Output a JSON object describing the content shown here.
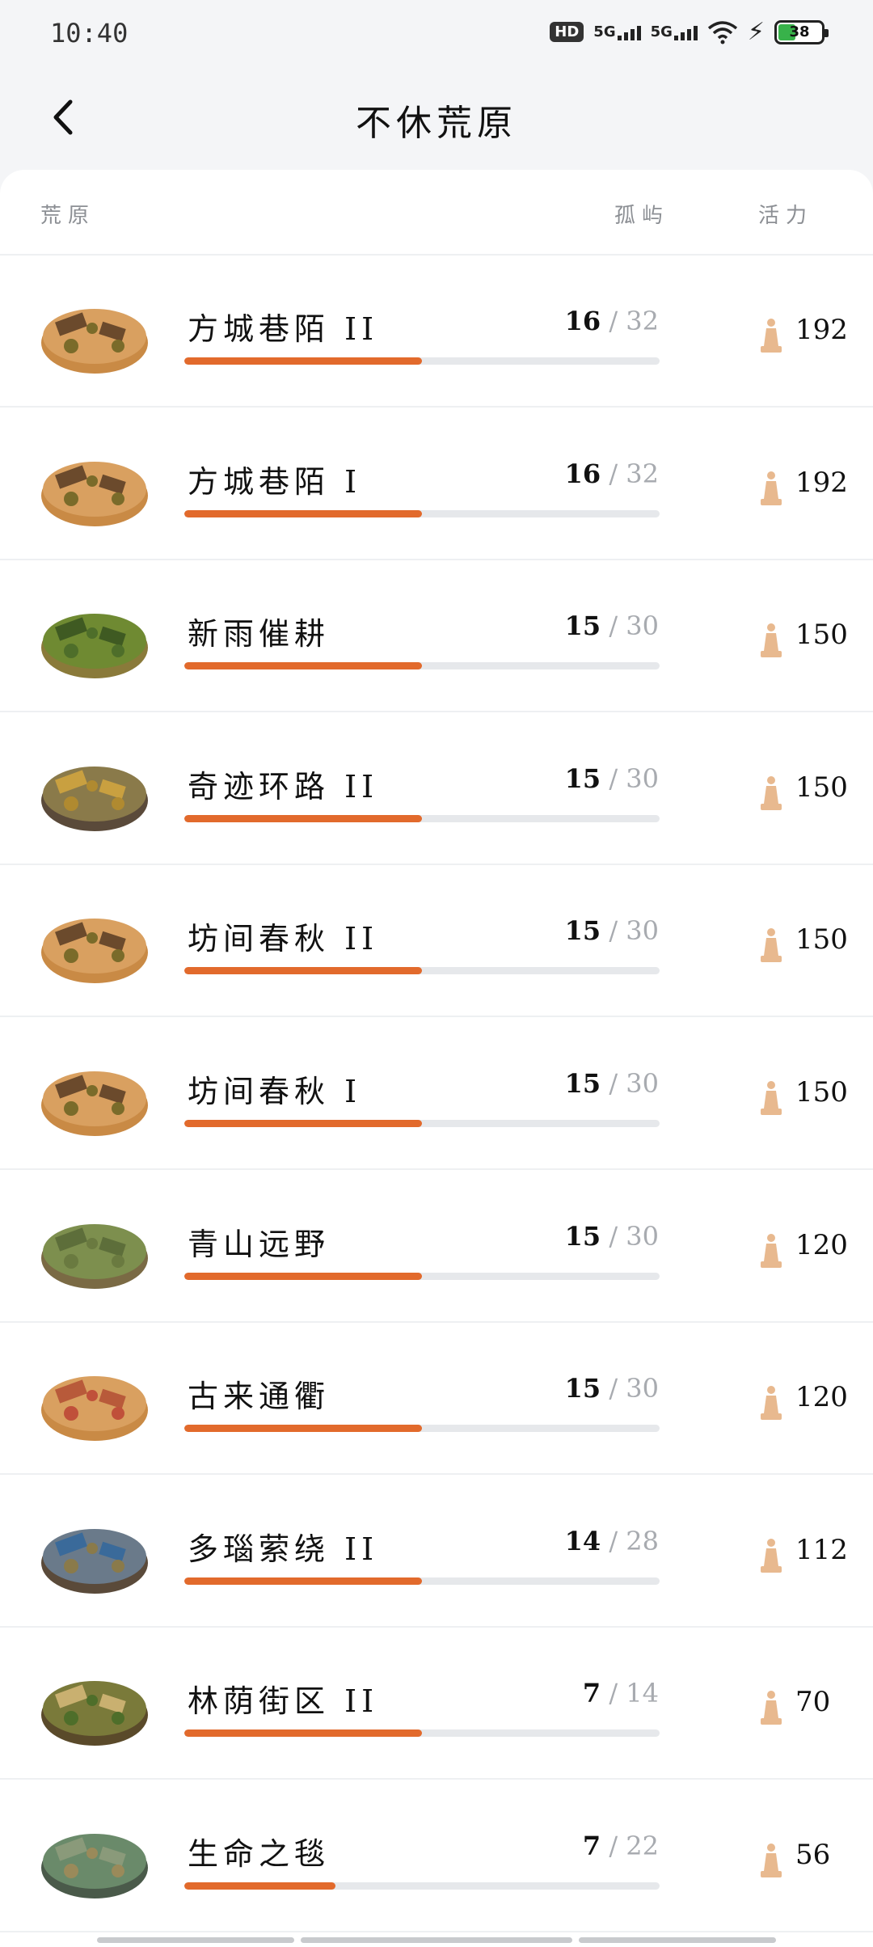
{
  "status_bar": {
    "time": "10:40",
    "hd_label": "HD",
    "network_1": "5G",
    "network_2": "5G",
    "battery_percent": "38"
  },
  "header": {
    "title": "不休荒原",
    "back_icon": "chevron-left-icon"
  },
  "columns": {
    "map": "荒原",
    "island": "孤屿",
    "energy": "活力"
  },
  "colors": {
    "accent": "#e26a2c",
    "track": "#e6e8eb",
    "energy_icon": "#e8b98f"
  },
  "rows": [
    {
      "name": "方城巷陌 II",
      "current": "16",
      "total": "32",
      "progress": 0.5,
      "energy": "192",
      "thumb": "city-walls"
    },
    {
      "name": "方城巷陌 I",
      "current": "16",
      "total": "32",
      "progress": 0.5,
      "energy": "192",
      "thumb": "city-walls"
    },
    {
      "name": "新雨催耕",
      "current": "15",
      "total": "30",
      "progress": 0.5,
      "energy": "150",
      "thumb": "forest"
    },
    {
      "name": "奇迹环路 II",
      "current": "15",
      "total": "30",
      "progress": 0.5,
      "energy": "150",
      "thumb": "trees-road"
    },
    {
      "name": "坊间春秋 II",
      "current": "15",
      "total": "30",
      "progress": 0.5,
      "energy": "150",
      "thumb": "city-walls"
    },
    {
      "name": "坊间春秋 I",
      "current": "15",
      "total": "30",
      "progress": 0.5,
      "energy": "150",
      "thumb": "city-walls"
    },
    {
      "name": "青山远野",
      "current": "15",
      "total": "30",
      "progress": 0.5,
      "energy": "120",
      "thumb": "grassland"
    },
    {
      "name": "古来通衢",
      "current": "15",
      "total": "30",
      "progress": 0.5,
      "energy": "120",
      "thumb": "desert-town"
    },
    {
      "name": "多瑙萦绕 II",
      "current": "14",
      "total": "28",
      "progress": 0.5,
      "energy": "112",
      "thumb": "river"
    },
    {
      "name": "林荫街区 II",
      "current": "7",
      "total": "14",
      "progress": 0.5,
      "energy": "70",
      "thumb": "village"
    },
    {
      "name": "生命之毯",
      "current": "7",
      "total": "22",
      "progress": 0.318,
      "energy": "56",
      "thumb": "meadow"
    }
  ]
}
